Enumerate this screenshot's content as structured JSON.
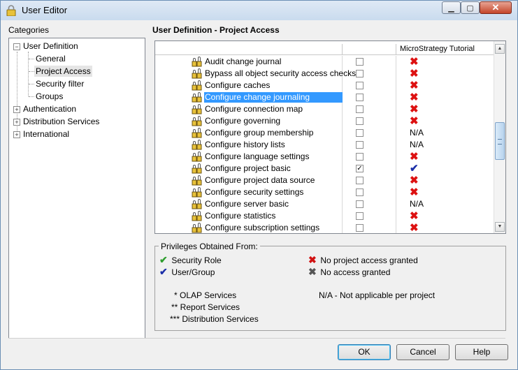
{
  "window": {
    "title": "User Editor"
  },
  "categories": {
    "label": "Categories",
    "tree": [
      {
        "label": "User Definition",
        "expander": "−",
        "children": [
          "General",
          "Project Access",
          "Security filter",
          "Groups"
        ]
      },
      {
        "label": "Authentication",
        "expander": "+"
      },
      {
        "label": "Distribution Services",
        "expander": "+"
      },
      {
        "label": "International",
        "expander": "+"
      }
    ],
    "selected": "Project Access"
  },
  "section_title": "User Definition - Project Access",
  "grid": {
    "column_project": "MicroStrategy Tutorial",
    "rows": [
      {
        "label": "Audit change journal",
        "checked": false,
        "status": "x"
      },
      {
        "label": "Bypass all object security access checks",
        "checked": false,
        "status": "x"
      },
      {
        "label": "Configure caches",
        "checked": false,
        "status": "x"
      },
      {
        "label": "Configure change journaling",
        "checked": false,
        "status": "x",
        "highlighted": true
      },
      {
        "label": "Configure connection map",
        "checked": false,
        "status": "x"
      },
      {
        "label": "Configure governing",
        "checked": false,
        "status": "x"
      },
      {
        "label": "Configure group membership",
        "checked": false,
        "status": "N/A"
      },
      {
        "label": "Configure history lists",
        "checked": false,
        "status": "N/A"
      },
      {
        "label": "Configure language settings",
        "checked": false,
        "status": "x"
      },
      {
        "label": "Configure project basic",
        "checked": true,
        "status": "check"
      },
      {
        "label": "Configure project data source",
        "checked": false,
        "status": "x"
      },
      {
        "label": "Configure security settings",
        "checked": false,
        "status": "x"
      },
      {
        "label": "Configure server basic",
        "checked": false,
        "status": "N/A"
      },
      {
        "label": "Configure statistics",
        "checked": false,
        "status": "x"
      },
      {
        "label": "Configure subscription settings",
        "checked": false,
        "status": "x"
      }
    ]
  },
  "legend": {
    "title": "Privileges Obtained From:",
    "security_role": "Security Role",
    "user_group": "User/Group",
    "no_project_access": "No project access granted",
    "no_access": "No access granted",
    "olap": "* OLAP Services",
    "report": "** Report Services",
    "distribution": "*** Distribution Services",
    "na_note": "N/A - Not applicable per project",
    "colors": {
      "security_role": "#2f9e2f",
      "user_group": "#1b2fa8",
      "no_project_access": "#d11111",
      "no_access": "#555555"
    }
  },
  "buttons": {
    "ok": "OK",
    "cancel": "Cancel",
    "help": "Help"
  }
}
